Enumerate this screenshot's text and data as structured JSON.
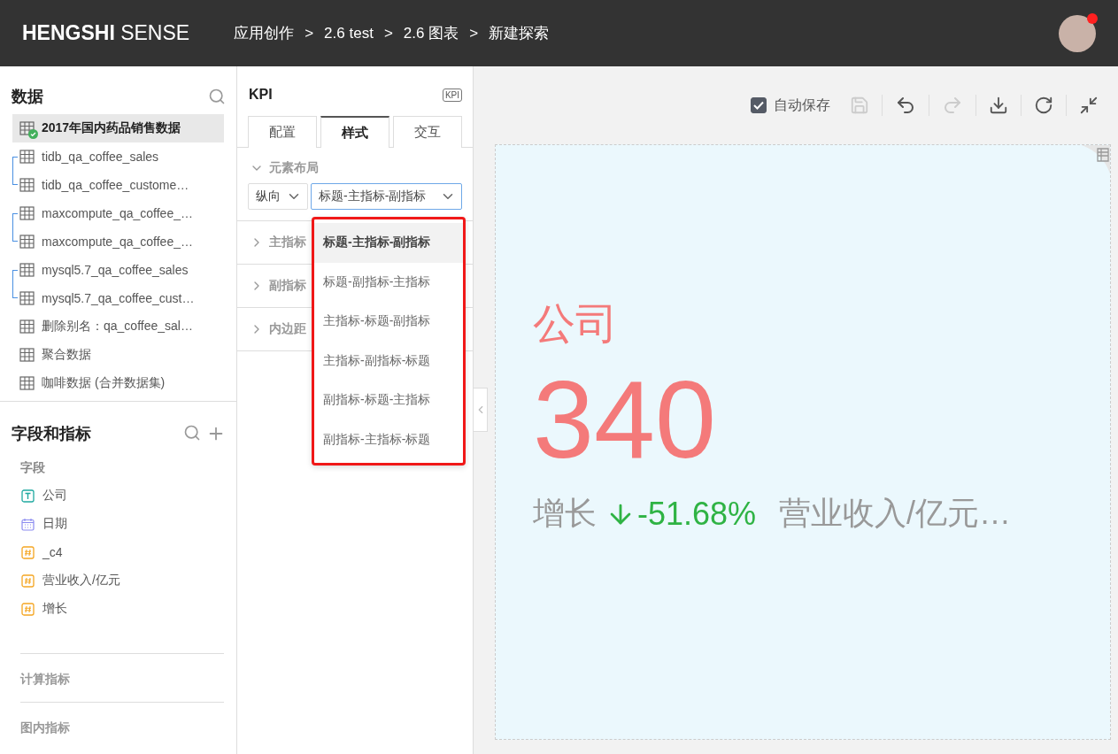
{
  "header": {
    "logo": "**HENGSHI** SENSE",
    "breadcrumbs": [
      "应用创作",
      "2.6 test",
      "2.6 图表",
      "新建探索"
    ],
    "separator": ">",
    "notification": true
  },
  "data_panel": {
    "title": "数据",
    "datasets": [
      {
        "kind": "table",
        "name": "2017年国内药品销售数据",
        "selected": true,
        "synced": true
      },
      {
        "kind": "group",
        "items": [
          {
            "name": "tidb_qa_coffee_sales"
          },
          {
            "name": "tidb_qa_coffee_custome…"
          }
        ]
      },
      {
        "kind": "group",
        "items": [
          {
            "name": "maxcompute_qa_coffee_…"
          },
          {
            "name": "maxcompute_qa_coffee_…"
          }
        ]
      },
      {
        "kind": "group",
        "items": [
          {
            "name": "mysql5.7_qa_coffee_sales"
          },
          {
            "name": "mysql5.7_qa_coffee_cust…"
          }
        ]
      },
      {
        "kind": "table",
        "name": "删除别名：qa_coffee_sal…",
        "selected": false,
        "synced": false
      },
      {
        "kind": "table",
        "name": "聚合数据",
        "selected": false,
        "synced": false
      },
      {
        "kind": "table",
        "name": "咖啡数据 (合并数据集)",
        "selected": false,
        "synced": false
      }
    ]
  },
  "fields_panel": {
    "title": "字段和指标",
    "group_label": "字段",
    "fields": [
      {
        "kind": "text",
        "name": "公司"
      },
      {
        "kind": "date",
        "name": "日期"
      },
      {
        "kind": "number",
        "name": "_c4"
      },
      {
        "kind": "number",
        "name": "营业收入/亿元"
      },
      {
        "kind": "number",
        "name": "增长"
      }
    ],
    "sections": [
      "计算指标",
      "图内指标"
    ]
  },
  "config_panel": {
    "title": "KPI",
    "badge": "KPI",
    "tabs": [
      {
        "label": "配置",
        "selected": false
      },
      {
        "label": "样式",
        "selected": true
      },
      {
        "label": "交互",
        "selected": false
      }
    ],
    "layout_section": {
      "label": "元素布局",
      "expanded": true,
      "direction": "纵向",
      "order": "标题-主指标-副指标"
    },
    "sections": [
      {
        "label": "主指标",
        "expanded": false
      },
      {
        "label": "副指标",
        "expanded": false
      },
      {
        "label": "内边距",
        "expanded": false
      }
    ],
    "dropdown": {
      "options": [
        {
          "label": "标题-主指标-副指标",
          "selected": true
        },
        {
          "label": "标题-副指标-主指标",
          "selected": false
        },
        {
          "label": "主指标-标题-副指标",
          "selected": false
        },
        {
          "label": "主指标-副指标-标题",
          "selected": false
        },
        {
          "label": "副指标-标题-主指标",
          "selected": false
        },
        {
          "label": "副指标-主指标-标题",
          "selected": false
        }
      ]
    }
  },
  "toolbar": {
    "autosave": {
      "label": "自动保存",
      "checked": true
    }
  },
  "kpi_card": {
    "title": "公司",
    "value": "340",
    "sub_label": "增长",
    "change": "-51.68%",
    "falling": true,
    "extra": "营业收入/亿元…"
  }
}
